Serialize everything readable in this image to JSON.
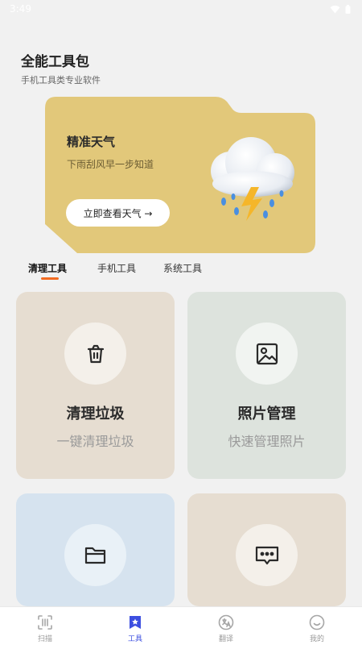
{
  "status_bar": {
    "time": "3:49"
  },
  "header": {
    "title": "全能工具包",
    "subtitle": "手机工具类专业软件"
  },
  "banner": {
    "title": "精准天气",
    "description": "下雨刮风早一步知道",
    "button_label": "立即查看天气 →",
    "color": "#e2c87a",
    "icon": "thunderstorm-cloud-icon"
  },
  "tabs": [
    {
      "label": "清理工具",
      "active": true
    },
    {
      "label": "手机工具",
      "active": false
    },
    {
      "label": "系统工具",
      "active": false
    }
  ],
  "cards": [
    {
      "title": "清理垃圾",
      "description": "一键清理垃圾",
      "icon": "trash-icon",
      "color": "#e6ddd1"
    },
    {
      "title": "照片管理",
      "description": "快速管理照片",
      "icon": "image-icon",
      "color": "#dde3dd"
    },
    {
      "title": "",
      "description": "",
      "icon": "folder-icon",
      "color": "#d6e3ef"
    },
    {
      "title": "",
      "description": "",
      "icon": "message-icon",
      "color": "#e6ddd1"
    }
  ],
  "bottom_nav": [
    {
      "label": "扫描",
      "icon": "scan-icon",
      "active": false
    },
    {
      "label": "工具",
      "icon": "toolbox-icon",
      "active": true
    },
    {
      "label": "翻译",
      "icon": "translate-icon",
      "active": false
    },
    {
      "label": "我的",
      "icon": "profile-icon",
      "active": false
    }
  ],
  "accent_color": "#f26b21",
  "nav_active_color": "#3d4fe0"
}
